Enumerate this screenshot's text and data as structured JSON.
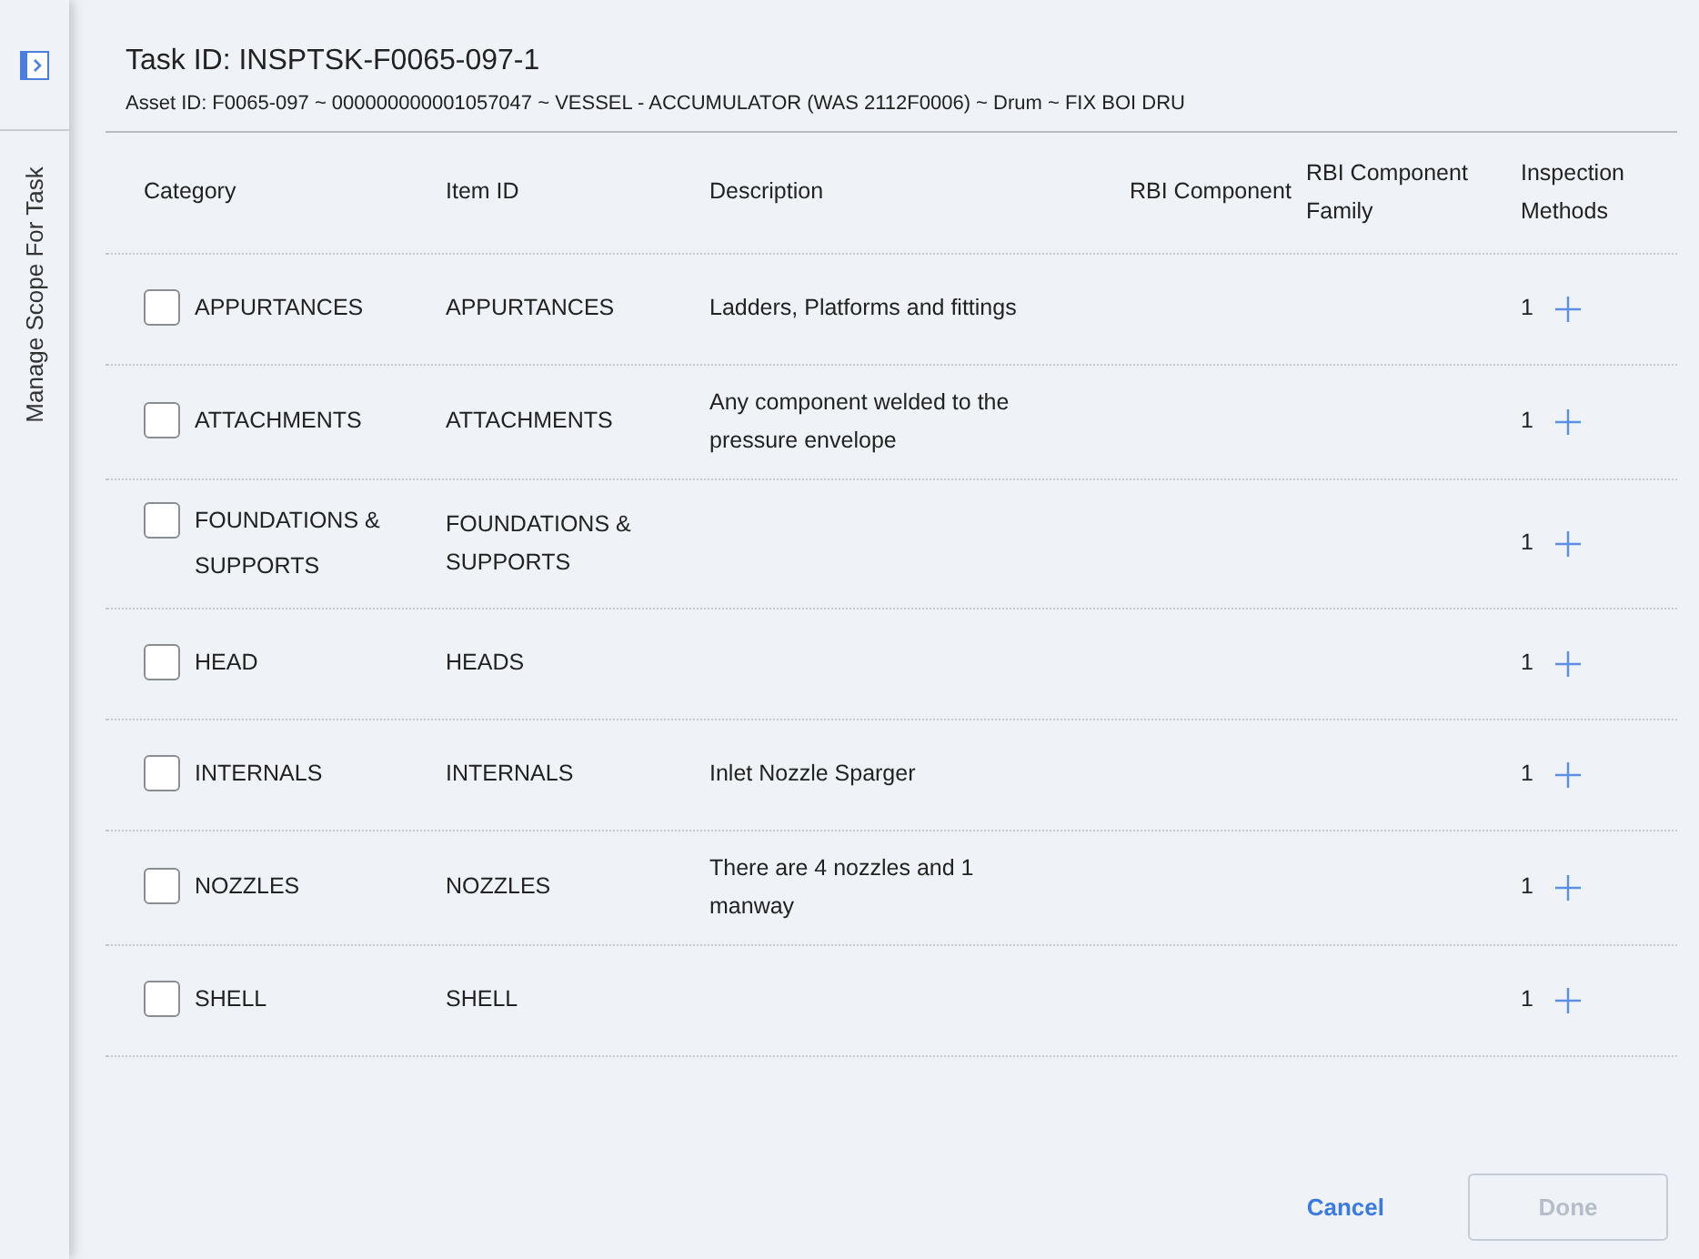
{
  "sidebar": {
    "title": "Manage Scope For Task"
  },
  "header": {
    "title": "Task ID: INSPTSK-F0065-097-1",
    "subtitle": "Asset ID: F0065-097 ~ 000000000001057047 ~ VESSEL - ACCUMULATOR (WAS 2112F0006) ~ Drum ~ FIX BOI DRU"
  },
  "table": {
    "columns": [
      "Category",
      "Item ID",
      "Description",
      "RBI Component",
      "RBI Component Family",
      "Inspection Methods"
    ],
    "rows": [
      {
        "checked": false,
        "category": "APPURTANCES",
        "item_id": "APPURTANCES",
        "description": "Ladders, Platforms and fittings",
        "methods": "1"
      },
      {
        "checked": false,
        "category": "ATTACHMENTS",
        "item_id": "ATTACHMENTS",
        "description": "Any component welded to the pressure envelope",
        "methods": "1"
      },
      {
        "checked": false,
        "category": "FOUNDATIONS & SUPPORTS",
        "item_id": "FOUNDATIONS & SUPPORTS",
        "methods": "1"
      },
      {
        "checked": false,
        "category": "HEAD",
        "item_id": "HEADS",
        "methods": "1"
      },
      {
        "checked": false,
        "category": "INTERNALS",
        "item_id": "INTERNALS",
        "description": "Inlet Nozzle Sparger",
        "methods": "1"
      },
      {
        "checked": false,
        "category": "NOZZLES",
        "item_id": "NOZZLES",
        "description": "There are 4 nozzles and 1 manway",
        "methods": "1"
      },
      {
        "checked": false,
        "category": "SHELL",
        "item_id": "SHELL",
        "methods": "1"
      }
    ]
  },
  "buttons": [
    {
      "kind": "link",
      "label": "Cancel",
      "disabled": false
    },
    {
      "kind": "outline",
      "label": "Done",
      "disabled": true
    }
  ]
}
